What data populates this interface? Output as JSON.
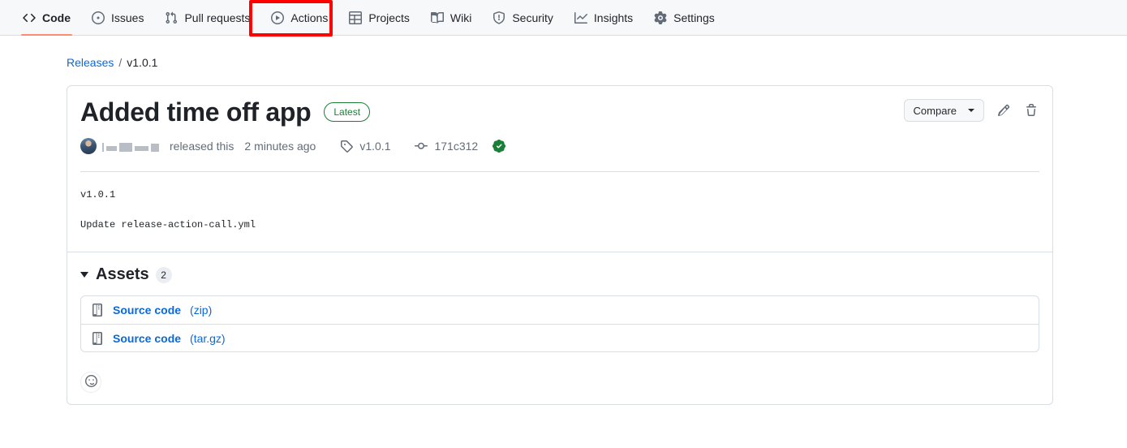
{
  "repo_nav": {
    "tabs": [
      {
        "label": "Code",
        "icon": "code-icon",
        "active": true
      },
      {
        "label": "Issues",
        "icon": "issue-opened-icon",
        "active": false
      },
      {
        "label": "Pull requests",
        "icon": "git-pull-request-icon",
        "active": false
      },
      {
        "label": "Actions",
        "icon": "play-icon",
        "active": false
      },
      {
        "label": "Projects",
        "icon": "table-icon",
        "active": false
      },
      {
        "label": "Wiki",
        "icon": "book-icon",
        "active": false
      },
      {
        "label": "Security",
        "icon": "shield-icon",
        "active": false
      },
      {
        "label": "Insights",
        "icon": "graph-icon",
        "active": false
      },
      {
        "label": "Settings",
        "icon": "gear-icon",
        "active": false
      }
    ],
    "annotation": {
      "target": "Actions",
      "color": "#ff0000"
    },
    "active_tab_underline_color": "#fd8c73"
  },
  "breadcrumb": {
    "root_label": "Releases",
    "separator": "/",
    "current_label": "v1.0.1"
  },
  "release": {
    "title": "Added time off app",
    "badge_label": "Latest",
    "badge_color": "#1a7f37",
    "actions": {
      "compare_label": "Compare",
      "edit_icon": "pencil-icon",
      "delete_icon": "trash-icon"
    },
    "meta": {
      "author_name": "",
      "released_text": "released this",
      "relative_time": "2 minutes ago",
      "tag_name": "v1.0.1",
      "commit_sha": "171c312",
      "verified": true
    },
    "body": [
      "v1.0.1",
      "Update release-action-call.yml"
    ]
  },
  "assets": {
    "section_label": "Assets",
    "count": "2",
    "items": [
      {
        "name": "Source code",
        "ext": "(zip)",
        "icon": "file-zip-icon"
      },
      {
        "name": "Source code",
        "ext": "(tar.gz)",
        "icon": "file-zip-icon"
      }
    ]
  },
  "reactions": {
    "add_label": "",
    "icon": "smiley-icon"
  }
}
